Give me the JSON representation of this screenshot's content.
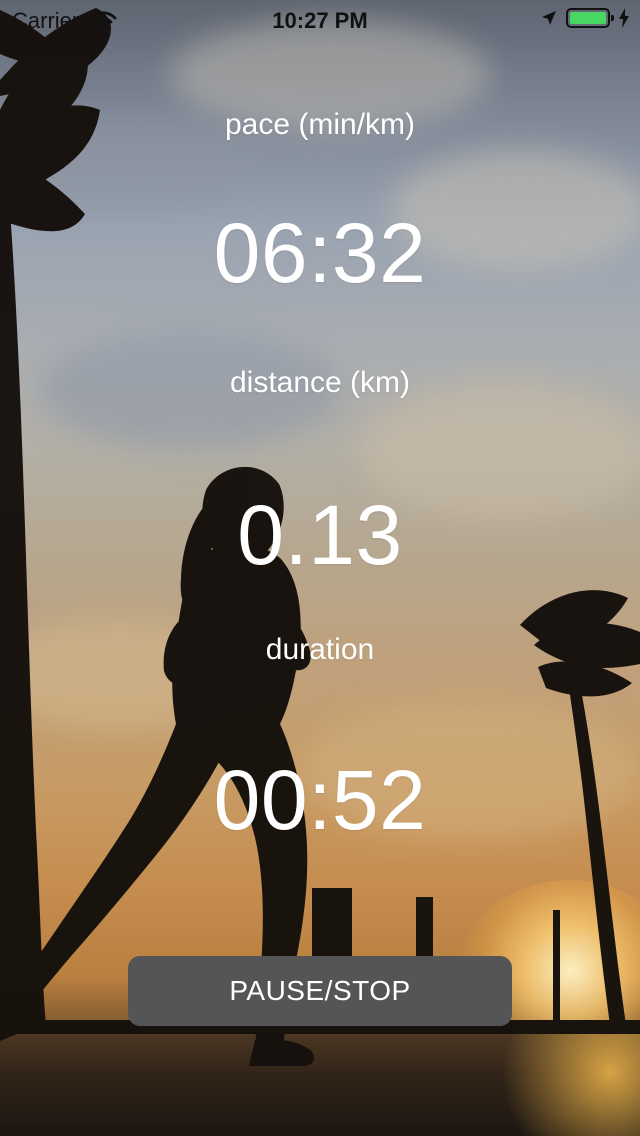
{
  "status_bar": {
    "carrier": "Carrier",
    "time": "10:27 PM",
    "battery_level": 1.0,
    "charging": true
  },
  "workout": {
    "pace": {
      "label": "pace (min/km)",
      "value": "06:32"
    },
    "distance": {
      "label": "distance (km)",
      "value": "0.13"
    },
    "duration": {
      "label": "duration",
      "value": "00:52"
    }
  },
  "controls": {
    "pause_stop_label": "PAUSE/STOP"
  },
  "colors": {
    "text": "#ffffff",
    "button": "#555558",
    "battery": "#48d760"
  },
  "icons": [
    "wifi-icon",
    "location-arrow-icon",
    "battery-icon",
    "charging-bolt-icon"
  ]
}
